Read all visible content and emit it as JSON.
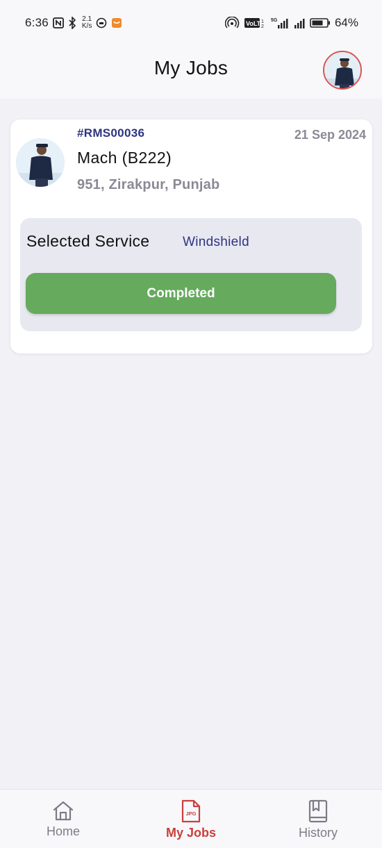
{
  "status_bar": {
    "time": "6:36",
    "speed_value": "2.1",
    "speed_unit": "K/s",
    "battery": "64%"
  },
  "header": {
    "title": "My Jobs"
  },
  "job": {
    "id": "#RMS00036",
    "date": "21 Sep 2024",
    "name": "Mach (B222)",
    "address": "951, Zirakpur, Punjab",
    "service_label": "Selected Service",
    "service_value": "Windshield",
    "status": "Completed"
  },
  "nav": {
    "items": [
      {
        "label": "Home",
        "icon": "home-icon"
      },
      {
        "label": "My Jobs",
        "icon": "jpg-file-icon",
        "active": true
      },
      {
        "label": "History",
        "icon": "book-icon"
      }
    ],
    "jpg_badge": "JPG"
  },
  "colors": {
    "accent_navy": "#2e3480",
    "success_green": "#66aa5e",
    "active_red": "#c9403a"
  }
}
